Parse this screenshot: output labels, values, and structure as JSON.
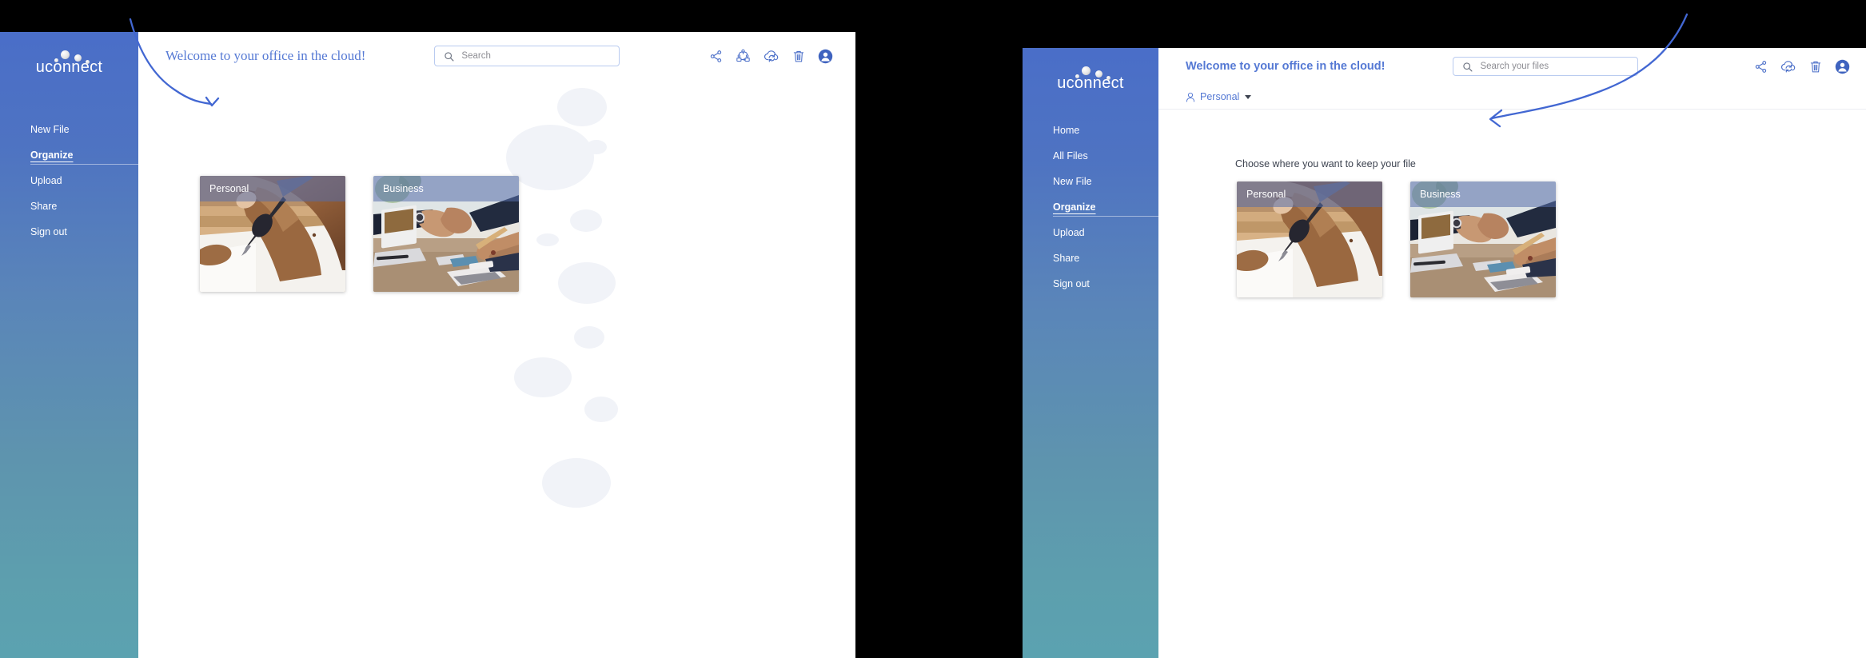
{
  "brand": {
    "logo_text": "uconnect",
    "accent_blue": "#5579d4",
    "sidebar_top": "#4a6ec8",
    "sidebar_bottom": "#5ba2b0"
  },
  "left_window": {
    "header": {
      "welcome": "Welcome to your office in the cloud!"
    },
    "search": {
      "placeholder": "Search"
    },
    "toolbar_icons": [
      {
        "name": "share-icon",
        "label": "Share"
      },
      {
        "name": "org-chart-icon",
        "label": "Collaborate"
      },
      {
        "name": "cloud-sync-icon",
        "label": "Sync"
      },
      {
        "name": "trash-icon",
        "label": "Trash"
      },
      {
        "name": "avatar-icon",
        "label": "Account"
      }
    ],
    "sidebar": {
      "items": [
        {
          "label": "New File",
          "active": false
        },
        {
          "label": "Organize",
          "active": true
        },
        {
          "label": "Upload",
          "active": false
        },
        {
          "label": "Share",
          "active": false
        },
        {
          "label": "Sign out",
          "active": false
        }
      ]
    },
    "cards": [
      {
        "title": "Personal",
        "image": "hand-writing-with-pen-on-paper"
      },
      {
        "title": "Business",
        "image": "business-handshake-at-meeting-table"
      }
    ]
  },
  "right_window": {
    "header": {
      "welcome": "Welcome to your office in the cloud!"
    },
    "search": {
      "placeholder": "Search your files"
    },
    "breadcrumb": {
      "label": "Personal"
    },
    "prompt": "Choose where you want to keep your file",
    "toolbar_icons": [
      {
        "name": "share-icon",
        "label": "Share"
      },
      {
        "name": "cloud-sync-icon",
        "label": "Sync"
      },
      {
        "name": "trash-icon",
        "label": "Trash"
      },
      {
        "name": "avatar-icon",
        "label": "Account"
      }
    ],
    "sidebar": {
      "items": [
        {
          "label": "Home",
          "active": false
        },
        {
          "label": "All Files",
          "active": false
        },
        {
          "label": "New File",
          "active": false
        },
        {
          "label": "Organize",
          "active": true
        },
        {
          "label": "Upload",
          "active": false
        },
        {
          "label": "Share",
          "active": false
        },
        {
          "label": "Sign out",
          "active": false
        }
      ]
    },
    "cards": [
      {
        "title": "Personal",
        "image": "hand-writing-with-pen-on-paper"
      },
      {
        "title": "Business",
        "image": "business-handshake-at-meeting-table"
      }
    ]
  }
}
